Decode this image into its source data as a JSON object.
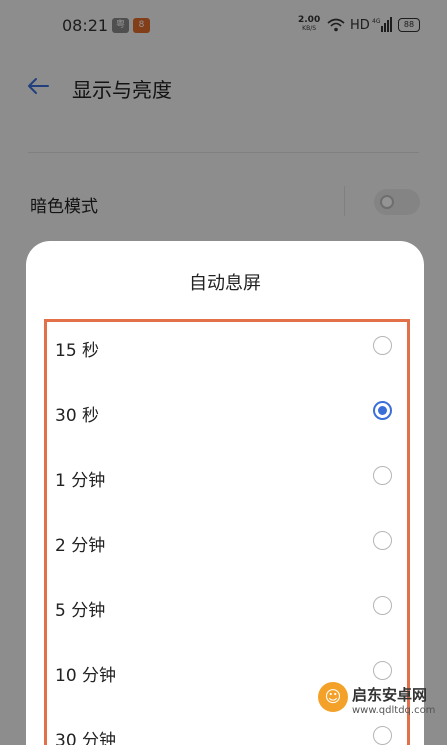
{
  "status_bar": {
    "time": "08:21",
    "notif_a": "粤",
    "notif_b": "8",
    "net_speed": "2.00",
    "net_unit": "KB/S",
    "hd": "HD",
    "signal": "4G",
    "battery": "88"
  },
  "header": {
    "title": "显示与亮度"
  },
  "settings": {
    "dark_mode_label": "暗色模式",
    "dark_mode_on": false
  },
  "dialog": {
    "title": "自动息屏",
    "options": [
      {
        "label": "15 秒",
        "selected": false
      },
      {
        "label": "30 秒",
        "selected": true
      },
      {
        "label": "1 分钟",
        "selected": false
      },
      {
        "label": "2 分钟",
        "selected": false
      },
      {
        "label": "5 分钟",
        "selected": false
      },
      {
        "label": "10 分钟",
        "selected": false
      },
      {
        "label": "30 分钟",
        "selected": false
      }
    ]
  },
  "watermark": {
    "text": "启东安卓网",
    "url": "www.qdltdq.com"
  },
  "colors": {
    "accent": "#3a6fd8",
    "highlight": "#e2714a"
  }
}
